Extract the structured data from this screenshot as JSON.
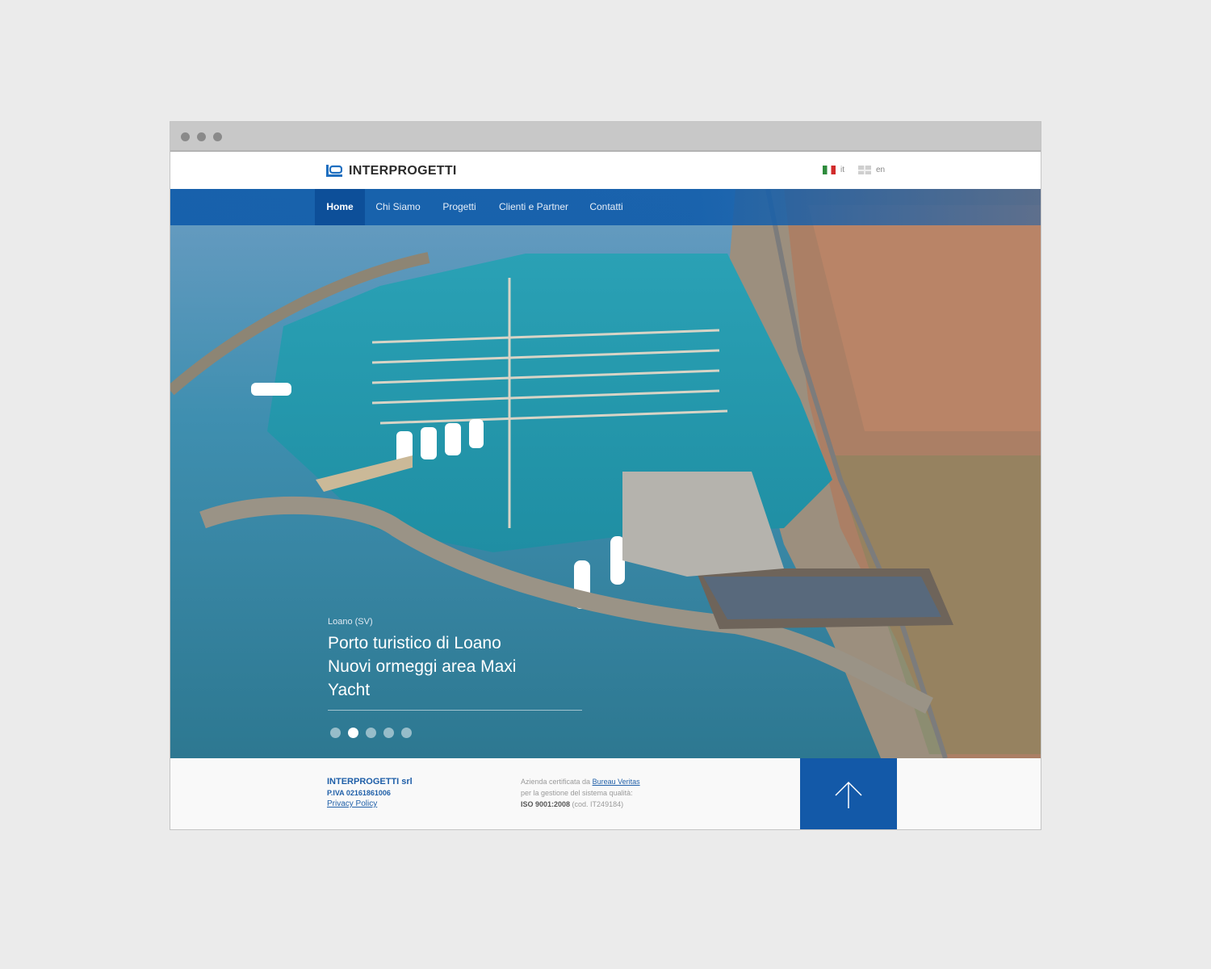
{
  "site": {
    "brand": "INTERPROGETTI",
    "languages": [
      {
        "code": "it",
        "label": "it"
      },
      {
        "code": "en",
        "label": "en"
      }
    ]
  },
  "nav": {
    "items": [
      {
        "label": "Home",
        "active": true
      },
      {
        "label": "Chi Siamo",
        "active": false
      },
      {
        "label": "Progetti",
        "active": false
      },
      {
        "label": "Clienti e Partner",
        "active": false
      },
      {
        "label": "Contatti",
        "active": false
      }
    ]
  },
  "hero": {
    "subtitle": "Loano (SV)",
    "title_lines": [
      "Porto turistico di Loano",
      "Nuovi ormeggi area Maxi",
      "Yacht"
    ],
    "slides_count": 5,
    "active_slide": 2
  },
  "footer": {
    "company": "INTERPROGETTI srl",
    "piva": "P.IVA 02161861006",
    "privacy": "Privacy Policy",
    "cert_prefix": "Azienda certificata da ",
    "cert_link": "Bureau Veritas",
    "cert_line2": "per la gestione del sistema qualità:",
    "iso": "ISO 9001:2008",
    "iso_code": " (cod. IT249184)"
  },
  "colors": {
    "brand_blue": "#1359a8",
    "nav_active": "#0d4f99",
    "background": "#ebebeb"
  },
  "icons": {
    "scroll_top": "arrow-up-icon",
    "logo": "interprogetti-logo-icon"
  }
}
